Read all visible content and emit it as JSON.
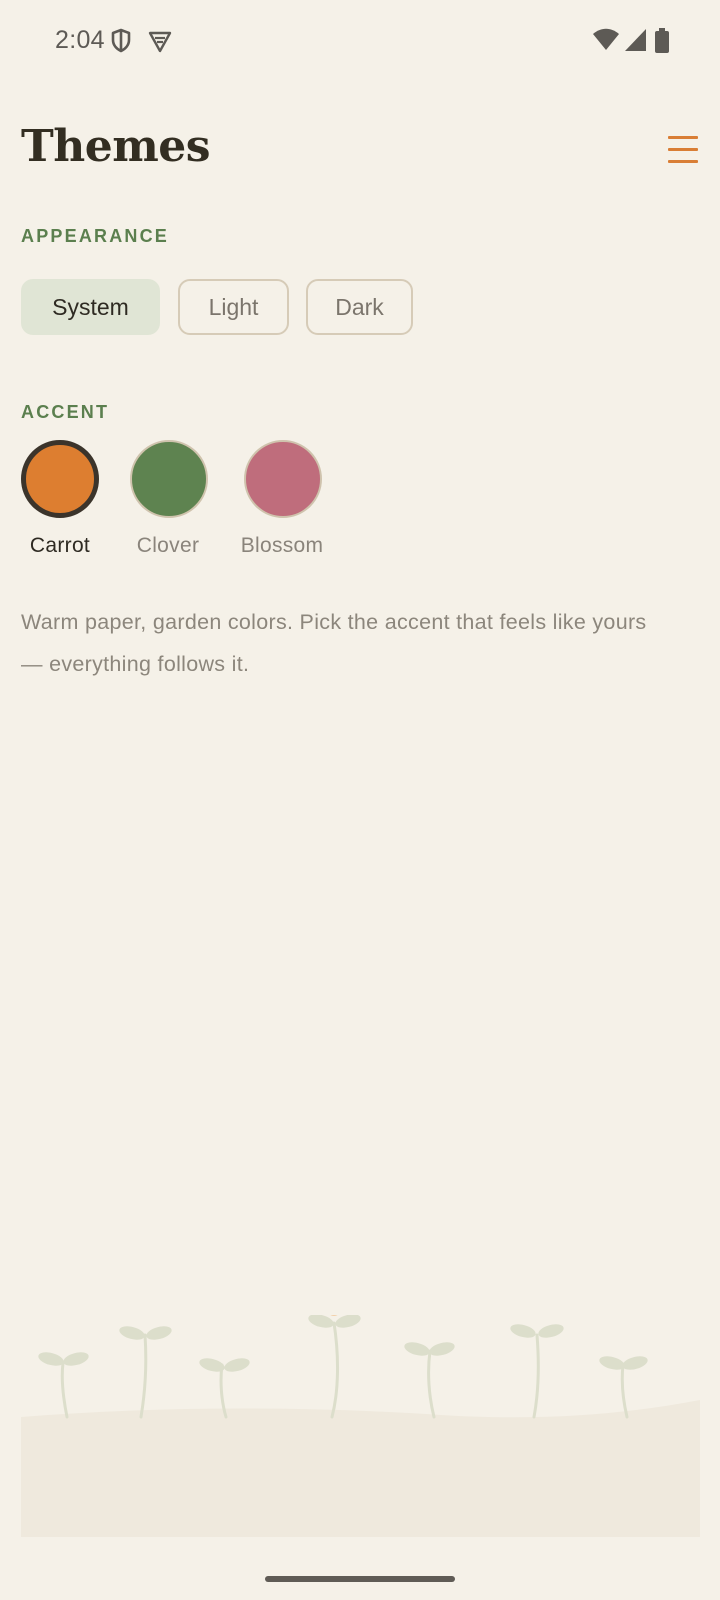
{
  "status_bar": {
    "time": "2:04",
    "icons": [
      "shield-icon",
      "vpn-icon",
      "wifi-icon",
      "signal-icon",
      "battery-icon"
    ]
  },
  "header": {
    "title": "Themes",
    "menu_icon": "hamburger-menu-icon"
  },
  "appearance": {
    "label": "APPEARANCE",
    "options": [
      {
        "label": "System",
        "selected": true
      },
      {
        "label": "Light",
        "selected": false
      },
      {
        "label": "Dark",
        "selected": false
      }
    ]
  },
  "accent": {
    "label": "ACCENT",
    "swatches": [
      {
        "name": "Carrot",
        "color": "#dd7e30",
        "selected": true
      },
      {
        "name": "Clover",
        "color": "#5e8350",
        "selected": false
      },
      {
        "name": "Blossom",
        "color": "#bf6d7c",
        "selected": false
      }
    ]
  },
  "description": "Warm paper, garden colors. Pick the accent that feels like yours — everything follows it.",
  "colors": {
    "background": "#f5f1e8",
    "accent_orange": "#d97e35",
    "section_green": "#5b7f4e",
    "selected_chip": "#e0e5d5"
  }
}
